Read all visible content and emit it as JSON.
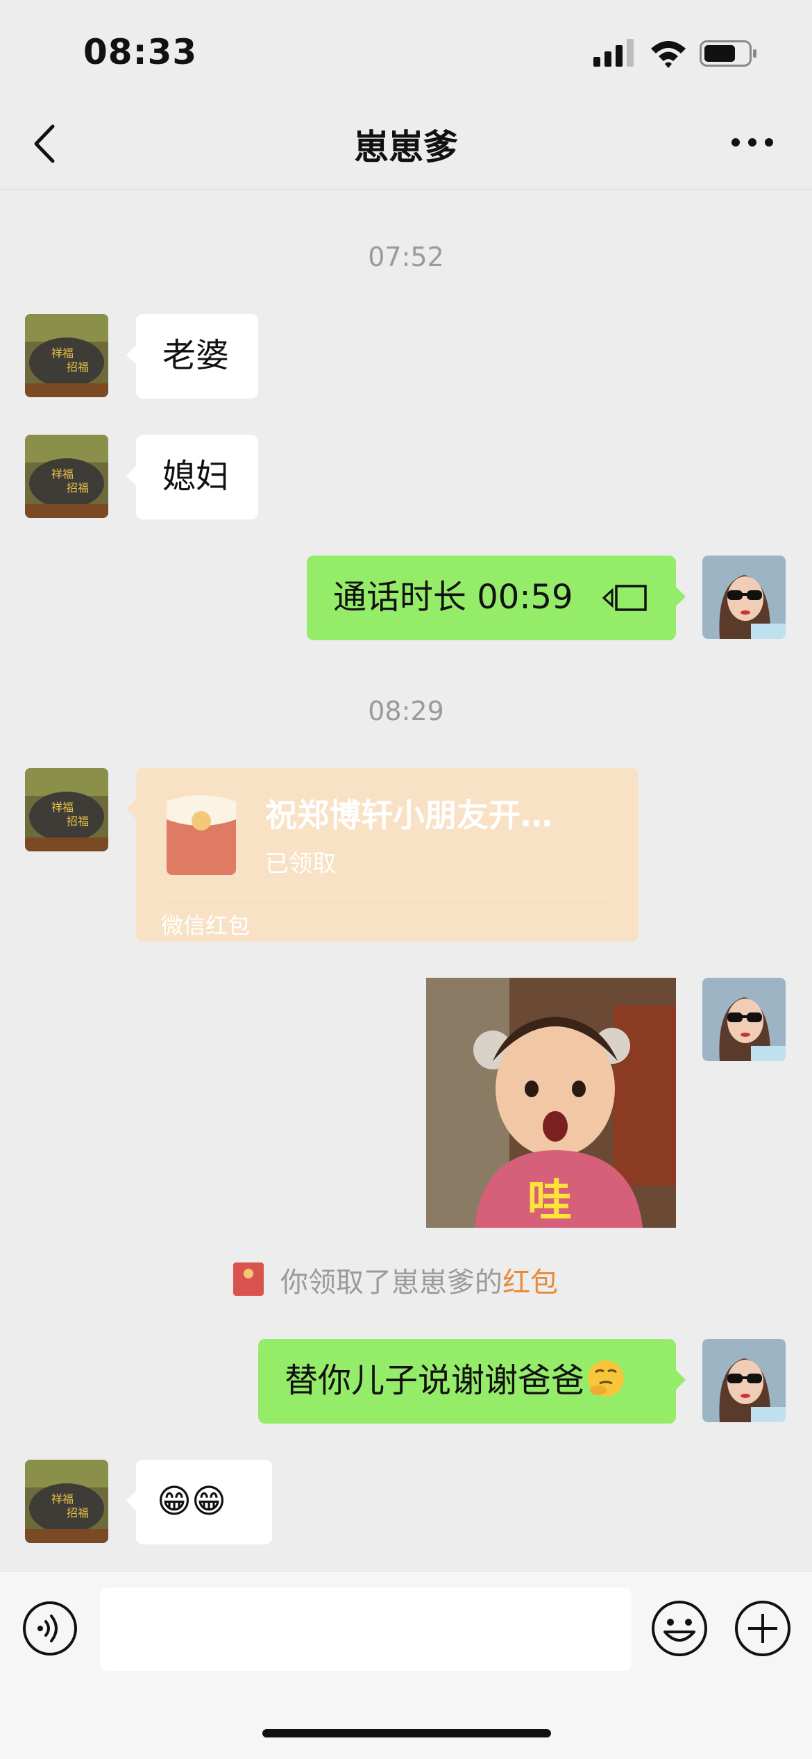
{
  "status_bar": {
    "time": "08:33"
  },
  "nav": {
    "title": "崽崽爹"
  },
  "messages": {
    "ts1": "07:52",
    "m1": "老婆",
    "m2": "媳妇",
    "call": "通话时长 00:59",
    "ts2": "08:29",
    "red_packet": {
      "title": "祝郑博轩小朋友开…",
      "status": "已领取",
      "footer": "微信红包"
    },
    "image_caption_overlay": "哇",
    "notice_prefix": "你领取了崽崽爹的",
    "notice_link": "红包",
    "thanks": "替你儿子说谢谢爸爸",
    "reply_emojis": "😁😁"
  },
  "input": {
    "placeholder": ""
  },
  "colors": {
    "incoming_bubble": "#ffffff",
    "outgoing_bubble": "#95ec69",
    "red_packet_bg": "#f8e1c4",
    "link": "#e88a3a",
    "background": "#ededed"
  },
  "icons": [
    "back-icon",
    "more-icon",
    "video-call-icon",
    "red-packet-icon",
    "voice-icon",
    "emoji-icon",
    "plus-icon"
  ]
}
